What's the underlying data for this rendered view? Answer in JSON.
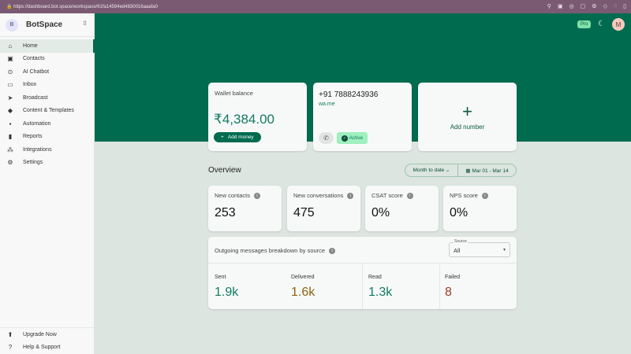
{
  "browser": {
    "url": "https://dashboard.bot.space/workspace/61fa14594ed4830016aaafa0"
  },
  "sidebar": {
    "avatar": "B",
    "workspace": "BotSpace",
    "items": [
      {
        "label": "Home",
        "icon": "home-icon",
        "glyph": "⌂"
      },
      {
        "label": "Contacts",
        "icon": "contacts-icon",
        "glyph": "▣"
      },
      {
        "label": "AI Chatbot",
        "icon": "chatbot-icon",
        "glyph": "⊙"
      },
      {
        "label": "Inbox",
        "icon": "inbox-icon",
        "glyph": "▭"
      },
      {
        "label": "Broadcast",
        "icon": "send-icon",
        "glyph": "➤"
      },
      {
        "label": "Content & Templates",
        "icon": "templates-icon",
        "glyph": "◆"
      },
      {
        "label": "Automation",
        "icon": "automation-icon",
        "glyph": "▪"
      },
      {
        "label": "Reports",
        "icon": "reports-icon",
        "glyph": "▮"
      },
      {
        "label": "Integrations",
        "icon": "integrations-icon",
        "glyph": "⁂"
      },
      {
        "label": "Settings",
        "icon": "gear-icon",
        "glyph": "⚙"
      }
    ],
    "bottom": [
      {
        "label": "Upgrade Now",
        "glyph": "⬆"
      },
      {
        "label": "Help & Support",
        "glyph": "?"
      }
    ]
  },
  "header": {
    "plan": "Pro",
    "user_initial": "M"
  },
  "wallet": {
    "title": "Wallet balance",
    "amount": "₹4,384.00",
    "button": "Add money"
  },
  "number": {
    "phone": "+91 7888243936",
    "link": "wa.me",
    "status": "Active"
  },
  "add_number": {
    "label": "Add number"
  },
  "overview": {
    "title": "Overview",
    "range": "Month to date",
    "dates": "Mar 01 - Mar 14"
  },
  "metrics": [
    {
      "label": "New contacts",
      "value": "253"
    },
    {
      "label": "New conversations",
      "value": "475"
    },
    {
      "label": "CSAT score",
      "value": "0%"
    },
    {
      "label": "NPS score",
      "value": "0%"
    }
  ],
  "breakdown": {
    "title": "Outgoing messages breakdown by source",
    "source_label": "Source",
    "source_value": "All",
    "stats": [
      {
        "label": "Sent",
        "value": "1.9k",
        "color": "#137a5e"
      },
      {
        "label": "Delivered",
        "value": "1.6k",
        "color": "#8a6410"
      },
      {
        "label": "Read",
        "value": "1.3k",
        "color": "#137a5e"
      },
      {
        "label": "Failed",
        "value": "8",
        "color": "#a33a22"
      }
    ]
  }
}
